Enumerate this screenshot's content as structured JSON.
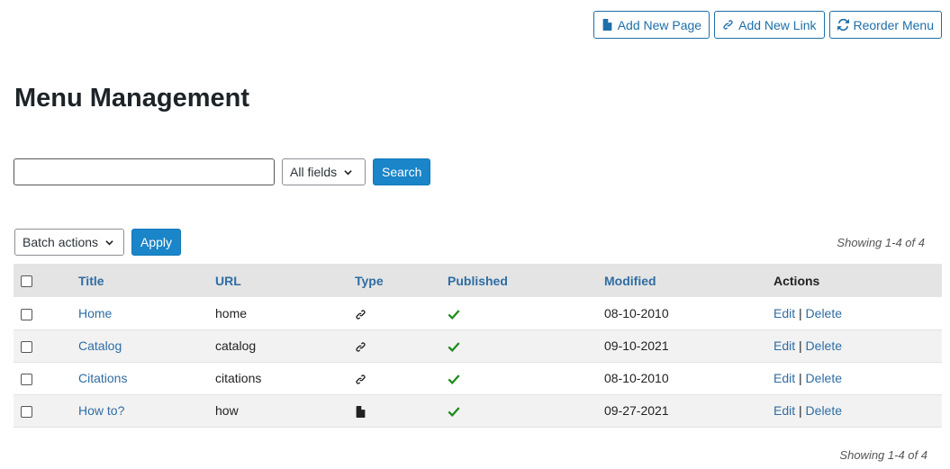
{
  "top_actions": {
    "add_page": "Add New Page",
    "add_link": "Add New Link",
    "reorder": "Reorder Menu"
  },
  "page_title": "Menu Management",
  "search": {
    "value": "",
    "field_select": "All fields",
    "button": "Search"
  },
  "batch": {
    "select": "Batch actions",
    "apply": "Apply"
  },
  "showing_top": "Showing 1-4 of 4",
  "showing_bottom": "Showing 1-4 of 4",
  "table": {
    "headers": {
      "title": "Title",
      "url": "URL",
      "type": "Type",
      "published": "Published",
      "modified": "Modified",
      "actions": "Actions"
    },
    "rows": [
      {
        "title": "Home",
        "url": "home",
        "type": "link-icon",
        "published": true,
        "modified": "08-10-2010",
        "edit": "Edit",
        "sep": "|",
        "delete": "Delete"
      },
      {
        "title": "Catalog",
        "url": "catalog",
        "type": "link-icon",
        "published": true,
        "modified": "09-10-2021",
        "edit": "Edit",
        "sep": "|",
        "delete": "Delete"
      },
      {
        "title": "Citations",
        "url": "citations",
        "type": "link-icon",
        "published": true,
        "modified": "08-10-2010",
        "edit": "Edit",
        "sep": "|",
        "delete": "Delete"
      },
      {
        "title": "How to?",
        "url": "how",
        "type": "page-icon",
        "published": true,
        "modified": "09-27-2021",
        "edit": "Edit",
        "sep": "|",
        "delete": "Delete"
      }
    ]
  },
  "colors": {
    "accent": "#1a85c8",
    "link": "#2f6da3",
    "check": "#1e8a1e"
  }
}
